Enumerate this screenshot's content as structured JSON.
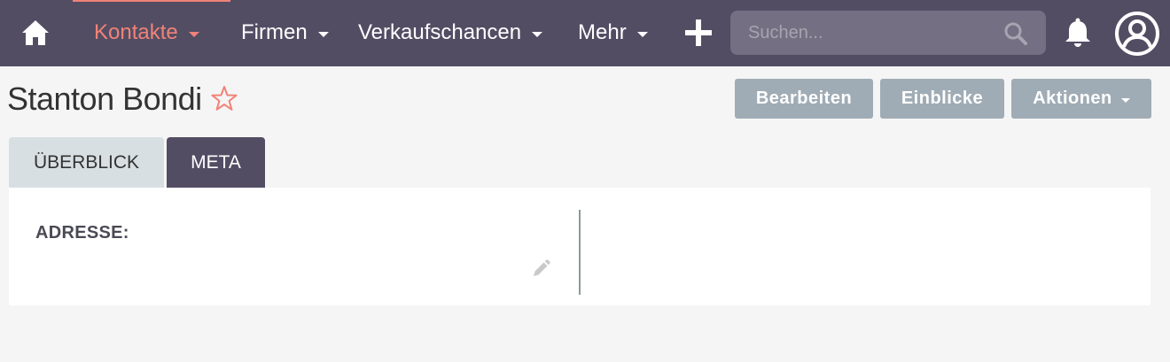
{
  "nav": {
    "items": [
      {
        "label": "Kontakte",
        "active": true
      },
      {
        "label": "Firmen",
        "active": false
      },
      {
        "label": "Verkaufschancen",
        "active": false
      },
      {
        "label": "Mehr",
        "active": false
      }
    ],
    "search_placeholder": "Suchen..."
  },
  "record": {
    "title": "Stanton Bondi",
    "favorite": false
  },
  "actions": {
    "edit_label": "Bearbeiten",
    "insights_label": "Einblicke",
    "actions_label": "Aktionen"
  },
  "tabs": [
    {
      "label": "ÜBERBLICK",
      "active": false
    },
    {
      "label": "META",
      "active": true
    }
  ],
  "panel": {
    "address_label": "ADRESSE:",
    "address_value": ""
  },
  "colors": {
    "nav_bg": "#534d64",
    "accent": "#f08377",
    "button_bg": "#a0acb5",
    "tab_inactive": "#d8dfe3"
  },
  "icons": [
    "home-icon",
    "caret-down-icon",
    "plus-icon",
    "search-icon",
    "bell-icon",
    "user-avatar-icon",
    "star-icon",
    "pencil-icon"
  ]
}
